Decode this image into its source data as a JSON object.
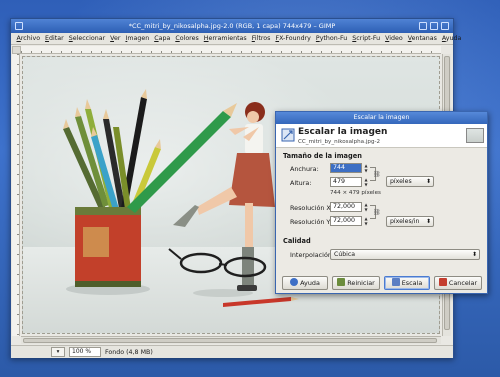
{
  "window": {
    "title": "*CC_mitri_by_nikosalpha.jpg-2.0 (RGB, 1 capa) 744x479 – GIMP"
  },
  "menubar": {
    "items": [
      "Archivo",
      "Editar",
      "Seleccionar",
      "Ver",
      "Imagen",
      "Capa",
      "Colores",
      "Herramientas",
      "Filtros",
      "FX-Foundry",
      "Python-Fu",
      "Script-Fu",
      "Video",
      "Ventanas",
      "Ayuda"
    ]
  },
  "statusbar": {
    "zoom": "100 %",
    "info": "Fondo (4,8 MB)"
  },
  "dialog": {
    "title": "Escalar la imagen",
    "heading": "Escalar la imagen",
    "subheading": "CC_mitri_by_nikosalpha.jpg-2",
    "size_section": "Tamaño de la imagen",
    "width_label": "Anchura:",
    "width_value": "744",
    "height_label": "Altura:",
    "height_value": "479",
    "size_note": "744 × 479 píxeles",
    "unit": "píxeles",
    "res_x_label": "Resolución X:",
    "res_x_value": "72,000",
    "res_y_label": "Resolución Y:",
    "res_y_value": "72,000",
    "res_unit": "píxeles/in",
    "quality_section": "Calidad",
    "interp_label": "Interpolación:",
    "interp_value": "Cúbica",
    "buttons": {
      "help": "Ayuda",
      "reset": "Reiniciar",
      "scale": "Escala",
      "cancel": "Cancelar"
    }
  },
  "colors": {
    "desktop": "#3566bd",
    "titlebar": "#3a6cc0",
    "accent_selection": "#3d6fc4"
  }
}
